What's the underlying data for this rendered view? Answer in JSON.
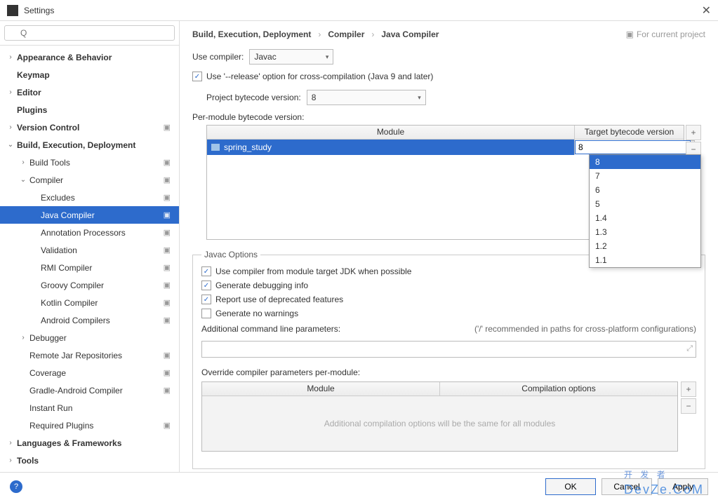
{
  "window": {
    "title": "Settings",
    "close_icon": "✕"
  },
  "search": {
    "placeholder": "Q"
  },
  "sidebar": [
    {
      "label": "Appearance & Behavior",
      "bold": true,
      "chev": "›",
      "indent": 0
    },
    {
      "label": "Keymap",
      "bold": true,
      "chev": "",
      "indent": 0
    },
    {
      "label": "Editor",
      "bold": true,
      "chev": "›",
      "indent": 0
    },
    {
      "label": "Plugins",
      "bold": true,
      "chev": "",
      "indent": 0
    },
    {
      "label": "Version Control",
      "bold": true,
      "chev": "›",
      "indent": 0,
      "badge": "▣"
    },
    {
      "label": "Build, Execution, Deployment",
      "bold": true,
      "chev": "⌄",
      "indent": 0
    },
    {
      "label": "Build Tools",
      "bold": false,
      "chev": "›",
      "indent": 1,
      "badge": "▣"
    },
    {
      "label": "Compiler",
      "bold": false,
      "chev": "⌄",
      "indent": 1,
      "badge": "▣"
    },
    {
      "label": "Excludes",
      "bold": false,
      "chev": "",
      "indent": 2,
      "badge": "▣"
    },
    {
      "label": "Java Compiler",
      "bold": false,
      "chev": "",
      "indent": 2,
      "badge": "▣",
      "selected": true
    },
    {
      "label": "Annotation Processors",
      "bold": false,
      "chev": "",
      "indent": 2,
      "badge": "▣"
    },
    {
      "label": "Validation",
      "bold": false,
      "chev": "",
      "indent": 2,
      "badge": "▣"
    },
    {
      "label": "RMI Compiler",
      "bold": false,
      "chev": "",
      "indent": 2,
      "badge": "▣"
    },
    {
      "label": "Groovy Compiler",
      "bold": false,
      "chev": "",
      "indent": 2,
      "badge": "▣"
    },
    {
      "label": "Kotlin Compiler",
      "bold": false,
      "chev": "",
      "indent": 2,
      "badge": "▣"
    },
    {
      "label": "Android Compilers",
      "bold": false,
      "chev": "",
      "indent": 2,
      "badge": "▣"
    },
    {
      "label": "Debugger",
      "bold": false,
      "chev": "›",
      "indent": 1
    },
    {
      "label": "Remote Jar Repositories",
      "bold": false,
      "chev": "",
      "indent": 1,
      "badge": "▣"
    },
    {
      "label": "Coverage",
      "bold": false,
      "chev": "",
      "indent": 1,
      "badge": "▣"
    },
    {
      "label": "Gradle-Android Compiler",
      "bold": false,
      "chev": "",
      "indent": 1,
      "badge": "▣"
    },
    {
      "label": "Instant Run",
      "bold": false,
      "chev": "",
      "indent": 1
    },
    {
      "label": "Required Plugins",
      "bold": false,
      "chev": "",
      "indent": 1,
      "badge": "▣"
    },
    {
      "label": "Languages & Frameworks",
      "bold": true,
      "chev": "›",
      "indent": 0
    },
    {
      "label": "Tools",
      "bold": true,
      "chev": "›",
      "indent": 0
    }
  ],
  "breadcrumb": {
    "a": "Build, Execution, Deployment",
    "b": "Compiler",
    "c": "Java Compiler",
    "note": "For current project"
  },
  "compiler": {
    "use_compiler_label": "Use compiler:",
    "use_compiler_value": "Javac",
    "release_opt": "Use '--release' option for cross-compilation (Java 9 and later)",
    "release_checked": true,
    "proj_bc_label": "Project bytecode version:",
    "proj_bc_value": "8",
    "per_module_label": "Per-module bytecode version:",
    "col_module": "Module",
    "col_target": "Target bytecode version",
    "module_name": "spring_study",
    "target_value": "8",
    "dropdown": [
      "8",
      "7",
      "6",
      "5",
      "1.4",
      "1.3",
      "1.2",
      "1.1"
    ]
  },
  "javac": {
    "legend": "Javac Options",
    "opt1": "Use compiler from module target JDK when possible",
    "c1": true,
    "opt2": "Generate debugging info",
    "c2": true,
    "opt3": "Report use of deprecated features",
    "c3": true,
    "opt4": "Generate no warnings",
    "c4": false,
    "addl_label": "Additional command line parameters:",
    "hint": "('/' recommended in paths for cross-platform configurations)",
    "override_label": "Override compiler parameters per-module:",
    "col_module": "Module",
    "col_opts": "Compilation options",
    "empty_msg": "Additional compilation options will be the same for all modules"
  },
  "buttons": {
    "ok": "OK",
    "cancel": "Cancel",
    "apply": "Apply",
    "help": "?"
  },
  "watermark": {
    "cn": "开 发 者",
    "en": "DevZe.CoM"
  }
}
